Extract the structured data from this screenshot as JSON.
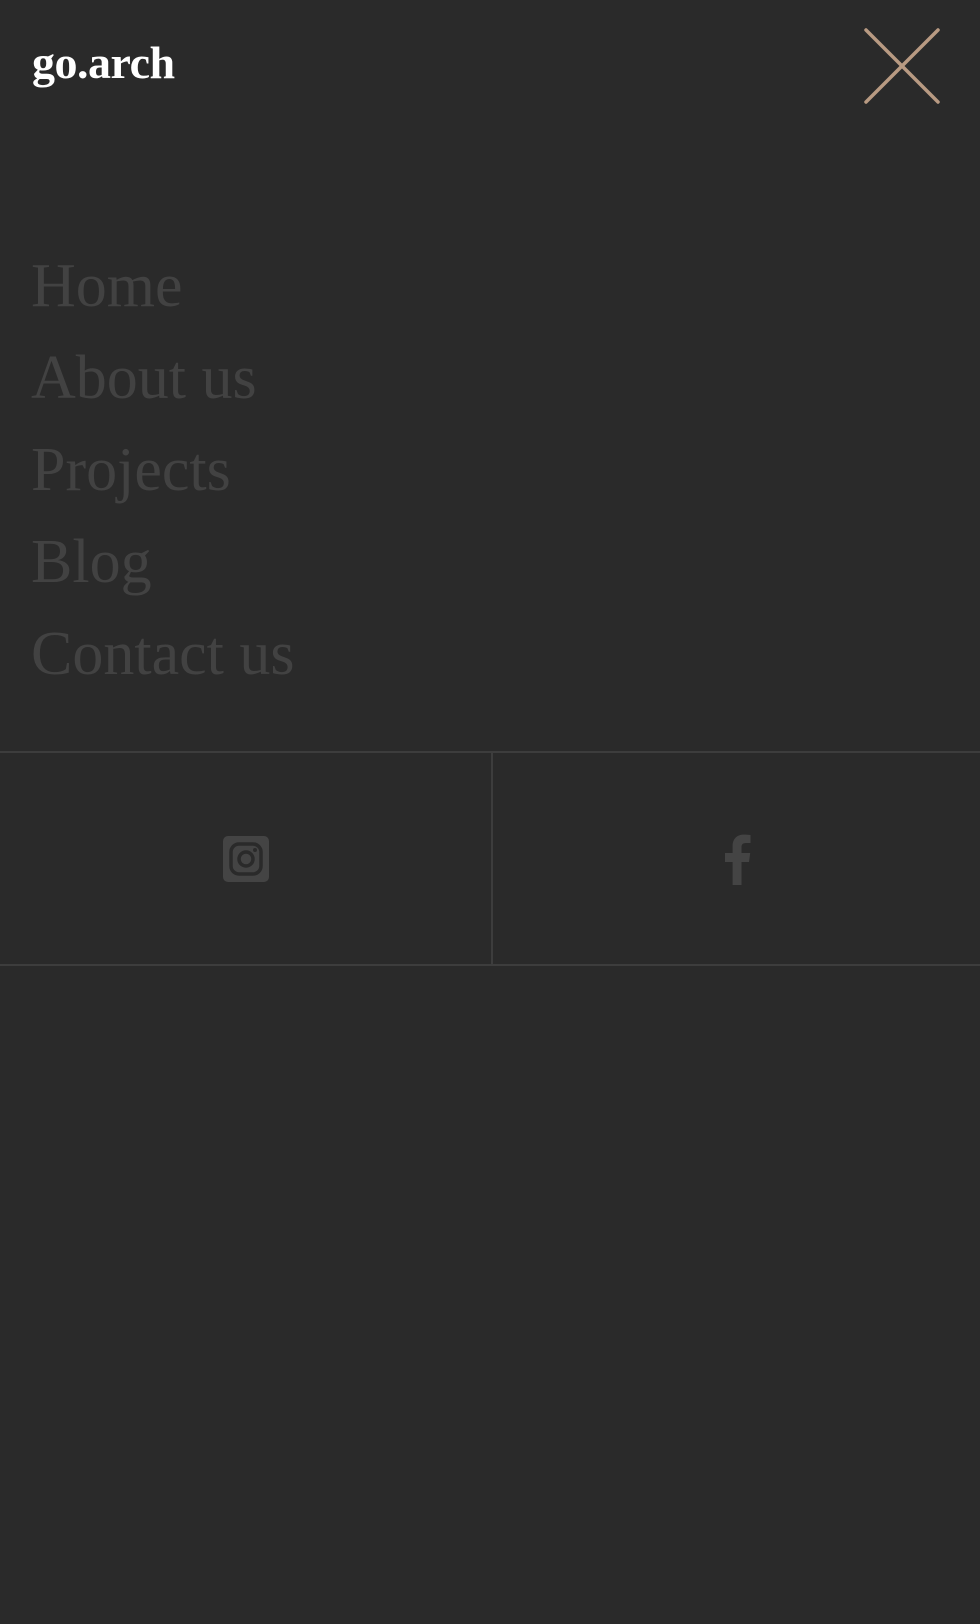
{
  "brand": {
    "logo_text": "go.arch"
  },
  "colors": {
    "background": "#2a2a2a",
    "logo": "#ffffff",
    "nav_text": "#424242",
    "close_icon": "#b89a82",
    "divider": "#3d3d3d",
    "social_icon": "#444444"
  },
  "header": {
    "close_icon": "close-icon"
  },
  "nav": {
    "items": [
      {
        "label": "Home"
      },
      {
        "label": "About us"
      },
      {
        "label": "Projects"
      },
      {
        "label": "Blog"
      },
      {
        "label": "Contact us"
      }
    ]
  },
  "social": {
    "items": [
      {
        "icon": "instagram-icon"
      },
      {
        "icon": "facebook-icon"
      }
    ]
  }
}
